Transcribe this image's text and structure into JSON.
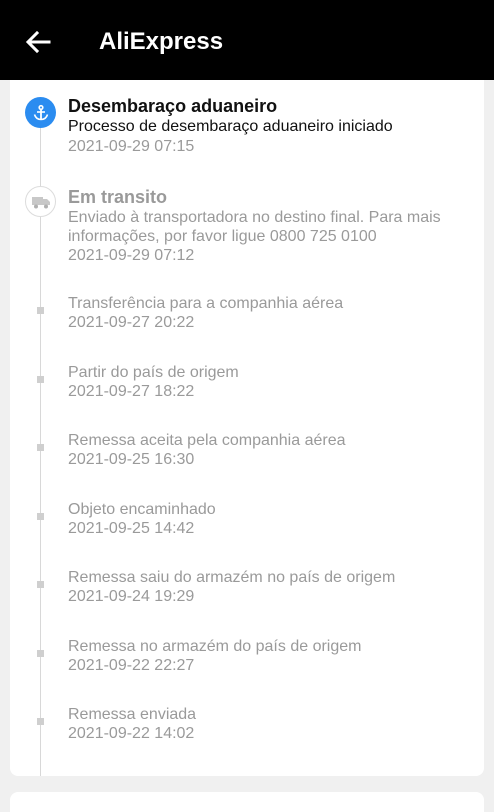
{
  "header": {
    "title": "AliExpress",
    "back_icon": "arrow-left-icon"
  },
  "tracking": {
    "events": [
      {
        "title": "Desembaraço aduaneiro",
        "description": "Processo de desembaraço aduaneiro iniciado",
        "time": "2021-09-29 07:15",
        "icon": "anchor-icon",
        "status": "active",
        "color": "#2b8cf0"
      },
      {
        "title": "Em transito",
        "description": "Enviado à transportadora no destino final. Para mais informações, por favor ligue 0800 725 0100",
        "time": "2021-09-29 07:12",
        "icon": "truck-icon",
        "status": "milestone"
      },
      {
        "description": "Transferência para a companhia aérea",
        "time": "2021-09-27 20:22"
      },
      {
        "description": "Partir do país de origem",
        "time": "2021-09-27 18:22"
      },
      {
        "description": "Remessa aceita pela companhia aérea",
        "time": "2021-09-25 16:30"
      },
      {
        "description": "Objeto encaminhado",
        "time": "2021-09-25 14:42"
      },
      {
        "description": "Remessa saiu do armazém no país de origem",
        "time": "2021-09-24 19:29"
      },
      {
        "description": "Remessa no armazém do país de origem",
        "time": "2021-09-22 22:27"
      },
      {
        "description": "Remessa enviada",
        "time": "2021-09-22 14:02"
      }
    ]
  }
}
